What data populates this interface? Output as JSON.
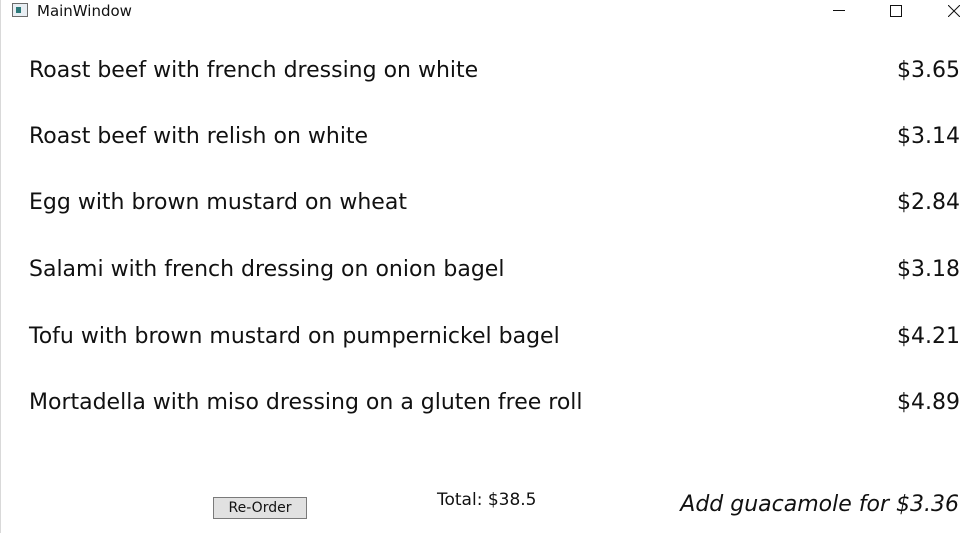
{
  "window": {
    "title": "MainWindow"
  },
  "menu": {
    "items": [
      {
        "name": "Roast beef with french dressing on white",
        "price": "$3.65"
      },
      {
        "name": "Roast beef with relish on white",
        "price": "$3.14"
      },
      {
        "name": "Egg with brown mustard on wheat",
        "price": "$2.84"
      },
      {
        "name": "Salami with french dressing on onion bagel",
        "price": "$3.18"
      },
      {
        "name": "Tofu with brown mustard on pumpernickel bagel",
        "price": "$4.21"
      },
      {
        "name": "Mortadella with miso dressing on a gluten free roll",
        "price": "$4.89"
      }
    ]
  },
  "footer": {
    "reorder_label": "Re-Order",
    "total_text": "Total: $38.5",
    "upsell_text": "Add guacamole for $3.36"
  },
  "icons": {
    "app": "app-window-icon",
    "minimize": "minimize-icon",
    "maximize": "maximize-icon",
    "close": "close-icon"
  }
}
